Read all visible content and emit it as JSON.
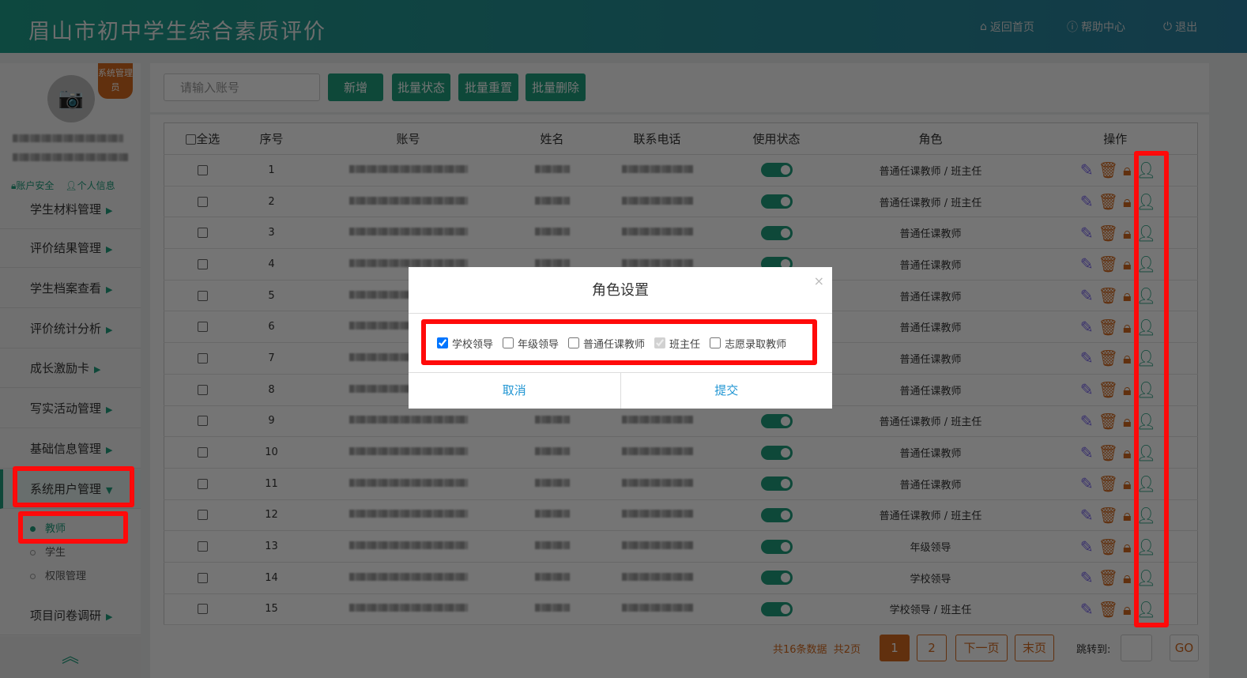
{
  "header": {
    "title": "眉山市初中学生综合素质评价",
    "home": "返回首页",
    "help": "帮助中心",
    "logout": "退出"
  },
  "sidebar": {
    "badge": "系统管理员",
    "links": [
      "账户安全",
      "个人信息"
    ],
    "menu": [
      "学生材料管理",
      "评价结果管理",
      "学生档案查看",
      "评价统计分析",
      "成长激励卡",
      "写实活动管理",
      "基础信息管理",
      "系统用户管理",
      "项目问卷调研"
    ],
    "active_menu": "系统用户管理",
    "submenu": [
      "教师",
      "学生",
      "权限管理"
    ],
    "active_sub": "教师"
  },
  "toolbar": {
    "search_placeholder": "请输入账号",
    "add": "新增",
    "batch_status": "批量状态",
    "batch_reset": "批量重置",
    "batch_delete": "批量删除"
  },
  "table": {
    "headers": [
      "全选",
      "序号",
      "账号",
      "姓名",
      "联系电话",
      "使用状态",
      "角色",
      "操作"
    ],
    "rows": [
      {
        "no": "1",
        "role": "普通任课教师 / 班主任",
        "enabled": true
      },
      {
        "no": "2",
        "role": "普通任课教师 / 班主任",
        "enabled": true
      },
      {
        "no": "3",
        "role": "普通任课教师",
        "enabled": true
      },
      {
        "no": "4",
        "role": "普通任课教师",
        "enabled": true
      },
      {
        "no": "5",
        "role": "普通任课教师",
        "enabled": true
      },
      {
        "no": "6",
        "role": "普通任课教师",
        "enabled": true
      },
      {
        "no": "7",
        "role": "普通任课教师",
        "enabled": true
      },
      {
        "no": "8",
        "role": "普通任课教师",
        "enabled": true
      },
      {
        "no": "9",
        "role": "普通任课教师 / 班主任",
        "enabled": true
      },
      {
        "no": "10",
        "role": "普通任课教师",
        "enabled": true
      },
      {
        "no": "11",
        "role": "普通任课教师",
        "enabled": true
      },
      {
        "no": "12",
        "role": "普通任课教师 / 班主任",
        "enabled": true
      },
      {
        "no": "13",
        "role": "年级领导",
        "enabled": true
      },
      {
        "no": "14",
        "role": "学校领导",
        "enabled": true
      },
      {
        "no": "15",
        "role": "学校领导 / 班主任",
        "enabled": true
      }
    ]
  },
  "pagination": {
    "summary": "共16条数据  共2页",
    "pages": [
      "1",
      "2"
    ],
    "current": "1",
    "next": "下一页",
    "last": "末页",
    "jump_label": "跳转到:",
    "go": "GO"
  },
  "modal": {
    "title": "角色设置",
    "close": "×",
    "options": [
      {
        "label": "学校领导",
        "checked": true,
        "disabled": false
      },
      {
        "label": "年级领导",
        "checked": false,
        "disabled": false
      },
      {
        "label": "普通任课教师",
        "checked": false,
        "disabled": false
      },
      {
        "label": "班主任",
        "checked": true,
        "disabled": true
      },
      {
        "label": "志愿录取教师",
        "checked": false,
        "disabled": false
      }
    ],
    "cancel": "取消",
    "submit": "提交"
  },
  "colors": {
    "brand": "#1e9c7c",
    "accent": "#d2691e",
    "highlight": "#ff0a0a",
    "link": "#2196d3"
  }
}
